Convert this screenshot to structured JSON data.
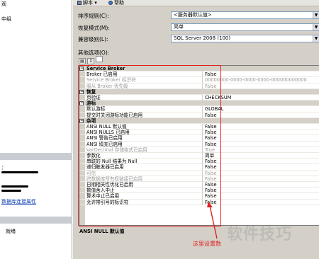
{
  "left_pane": {
    "item1": "观",
    "item2": "中组",
    "item3": "：",
    "link": "数据库连接属性",
    "item4": "就绪"
  },
  "toolbar": {
    "script_label": "脚本 ▾",
    "help_label": "帮助"
  },
  "form": {
    "collation_label": "排序规则(C):",
    "collation_value": "<服务器默认值>",
    "recovery_label": "恢复模式(M):",
    "recovery_value": "简单",
    "compat_label": "兼容级别(L):",
    "compat_value": "SQL Server 2008 (100)",
    "other_options_label": "其他选项(O):"
  },
  "property_grid": {
    "categories": [
      {
        "name": "Service Broker",
        "rows": [
          {
            "name": "Broker 已启用",
            "value": "False",
            "disabled": false
          },
          {
            "name": "Service Broker 标识符",
            "value": "00000000-0000-0000-0000-000000000000",
            "disabled": true
          },
          {
            "name": "服从 Broker 优先级",
            "value": "False",
            "disabled": true
          }
        ]
      },
      {
        "name": "恢复",
        "rows": [
          {
            "name": "页验证",
            "value": "CHECKSUM",
            "disabled": false
          }
        ]
      },
      {
        "name": "游标",
        "rows": [
          {
            "name": "默认游标",
            "value": "GLOBAL",
            "disabled": false
          },
          {
            "name": "提交时关闭游标功能已启用",
            "value": "False",
            "disabled": false
          }
        ]
      },
      {
        "name": "杂项",
        "rows": [
          {
            "name": "ANSI NULL 默认值",
            "value": "False",
            "disabled": false
          },
          {
            "name": "ANSI NULLS 已启用",
            "value": "False",
            "disabled": false
          },
          {
            "name": "ANSI 警告已启用",
            "value": "False",
            "disabled": false
          },
          {
            "name": "ANSI 填充已启用",
            "value": "False",
            "disabled": false
          },
          {
            "name": "VarDecimal 存储格式已启用",
            "value": "True",
            "disabled": true
          },
          {
            "name": "参数化",
            "value": "简单",
            "disabled": false
          },
          {
            "name": "串联的 Null 结果为 Null",
            "value": "False",
            "disabled": false
          },
          {
            "name": "递归触发器已启用",
            "value": "False",
            "disabled": false
          },
          {
            "name": "可信",
            "value": "False",
            "disabled": true
          },
          {
            "name": "跨数据库所有权链接已启用",
            "value": "False",
            "disabled": true
          },
          {
            "name": "日期相关性优化已启用",
            "value": "False",
            "disabled": false
          },
          {
            "name": "数值舍入中止",
            "value": "False",
            "disabled": false
          },
          {
            "name": "算术中止已启用",
            "value": "False",
            "disabled": false
          },
          {
            "name": "允许带引号的标识符",
            "value": "False",
            "disabled": false
          }
        ]
      }
    ]
  },
  "description": {
    "title": "ANSI NULL 默认值"
  },
  "annotation": "这里设置数",
  "watermark": "软件技巧",
  "colors": {
    "highlight_box": "#e01f1f",
    "window_bg": "#d4d0c8"
  }
}
